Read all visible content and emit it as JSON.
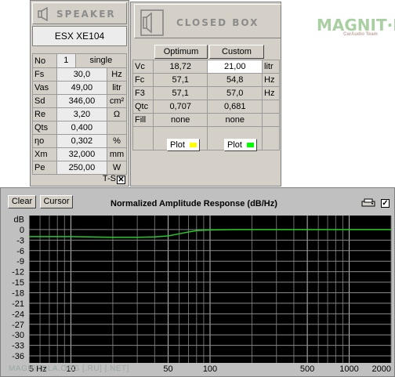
{
  "speaker": {
    "title": "SPEAKER",
    "model": "ESX XE104",
    "no_label": "No",
    "no_value": "1",
    "no_mode": "single",
    "rows": [
      {
        "label": "Fs",
        "value": "30,0",
        "unit": "Hz"
      },
      {
        "label": "Vas",
        "value": "49,00",
        "unit": "litr"
      },
      {
        "label": "Sd",
        "value": "346,00",
        "unit": "cm²"
      },
      {
        "label": "Re",
        "value": "3,20",
        "unit": "Ω"
      },
      {
        "label": "Qts",
        "value": "0,400",
        "unit": ""
      },
      {
        "label": "ηo",
        "value": "0,302",
        "unit": "%"
      },
      {
        "label": "Xm",
        "value": "32,000",
        "unit": "mm"
      },
      {
        "label": "Pe",
        "value": "250,00",
        "unit": "W"
      }
    ],
    "ts_label": "T-S",
    "ts_checked": "✕"
  },
  "box": {
    "title": "CLOSED BOX",
    "optimum_label": "Optimum",
    "custom_label": "Custom",
    "rows": [
      {
        "label": "Vc",
        "optimum": "18,72",
        "custom": "21,00",
        "unit": "litr"
      },
      {
        "label": "Fc",
        "optimum": "57,1",
        "custom": "54,8",
        "unit": "Hz"
      },
      {
        "label": "F3",
        "optimum": "57,1",
        "custom": "57,0",
        "unit": "Hz"
      },
      {
        "label": "Qtc",
        "optimum": "0,707",
        "custom": "0,681",
        "unit": ""
      },
      {
        "label": "Fill",
        "optimum": "none",
        "custom": "none",
        "unit": ""
      }
    ],
    "plot_label": "Plot",
    "optimum_color": "#ffff00",
    "custom_color": "#00ff00"
  },
  "logo": {
    "main": "MAGNIT·LA",
    "sub": "CarAudio Team"
  },
  "response": {
    "clear_label": "Clear",
    "cursor_label": "Cursor",
    "title": "Normalized Amplitude Response (dB/Hz)",
    "print_icon": "printer-icon",
    "checked": "✓",
    "watermark": "MAGNITOLA.ORG [.RU] [.NET]"
  },
  "chart_data": {
    "type": "line",
    "ylabel": "dB",
    "x_scale": "log",
    "xlim": [
      5,
      2000
    ],
    "ylim": [
      -38,
      4
    ],
    "y_ticks": [
      0,
      -3,
      -6,
      -9,
      -12,
      -15,
      -18,
      -21,
      -24,
      -27,
      -30,
      -33,
      -36
    ],
    "x_tick_labels": [
      {
        "x": 5,
        "label": "5 Hz"
      },
      {
        "x": 10,
        "label": "10"
      },
      {
        "x": 50,
        "label": "50"
      },
      {
        "x": 100,
        "label": "100"
      },
      {
        "x": 500,
        "label": "500"
      },
      {
        "x": 1000,
        "label": "1000"
      },
      {
        "x": 2000,
        "label": "2000"
      }
    ],
    "grid": true,
    "background": "#000000",
    "series": [
      {
        "color": "#22cc22",
        "x": [
          5,
          10,
          20,
          30,
          40,
          50,
          60,
          70,
          80,
          100,
          150,
          200,
          500,
          1000,
          2000
        ],
        "y": [
          -2,
          -2,
          -2.2,
          -2.2,
          -2.1,
          -1.8,
          -1.2,
          -0.7,
          -0.3,
          -0.1,
          0,
          0,
          0,
          0,
          0
        ]
      }
    ]
  }
}
